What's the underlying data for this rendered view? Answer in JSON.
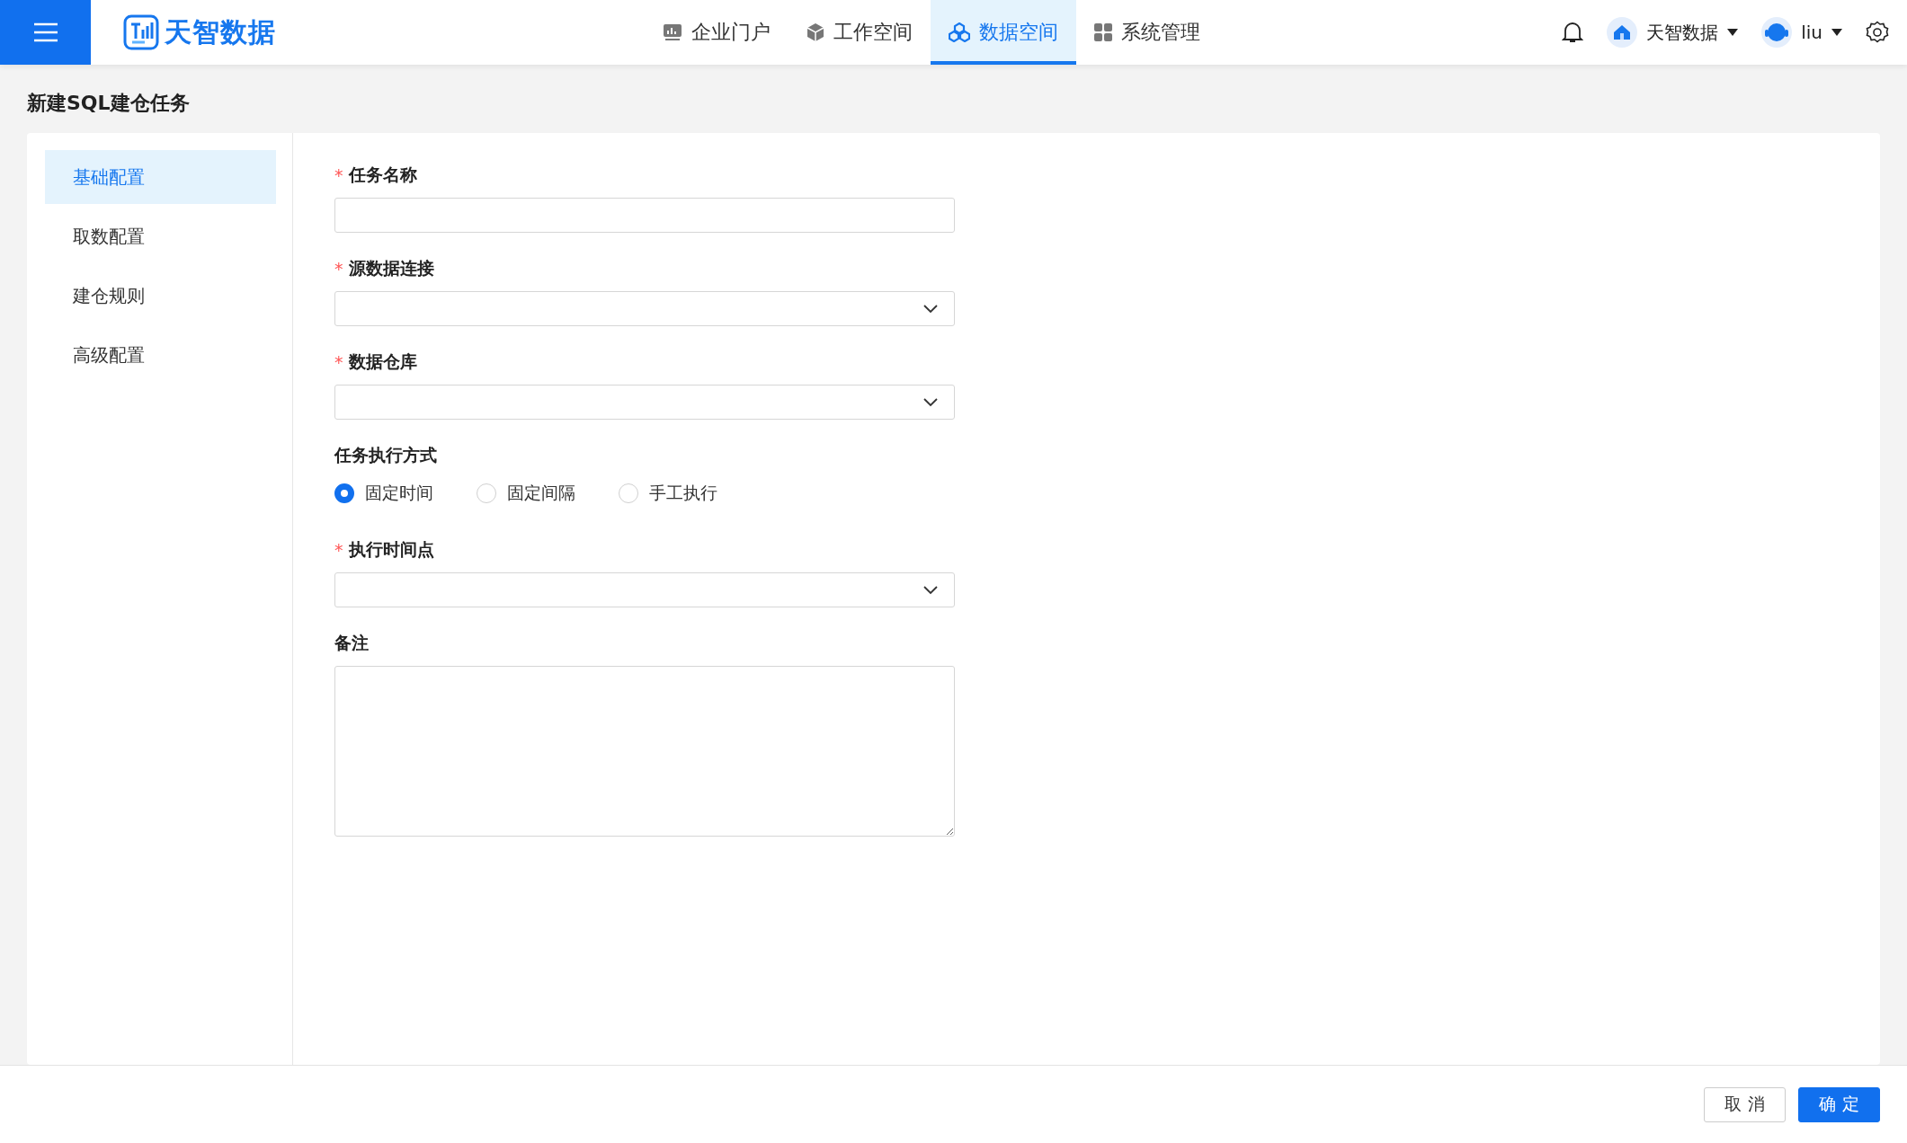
{
  "header": {
    "logo": "天智数据",
    "nav": [
      {
        "label": "企业门户",
        "selected": false
      },
      {
        "label": "工作空间",
        "selected": false
      },
      {
        "label": "数据空间",
        "selected": true
      },
      {
        "label": "系统管理",
        "selected": false
      }
    ],
    "org": "天智数据",
    "user": "liu"
  },
  "page_title": "新建SQL建仓任务",
  "sidebar": {
    "items": [
      {
        "label": "基础配置",
        "selected": true
      },
      {
        "label": "取数配置",
        "selected": false
      },
      {
        "label": "建仓规则",
        "selected": false
      },
      {
        "label": "高级配置",
        "selected": false
      }
    ]
  },
  "form": {
    "fields": [
      {
        "kind": "text",
        "label": "任务名称",
        "required_mark": "*"
      },
      {
        "kind": "select",
        "label": "源数据连接",
        "required_mark": "*"
      },
      {
        "kind": "select",
        "label": "数据仓库",
        "required_mark": "*"
      },
      {
        "kind": "radio",
        "label": "任务执行方式",
        "options": [
          {
            "label": "固定时间",
            "selected": true
          },
          {
            "label": "固定间隔",
            "selected": false
          },
          {
            "label": "手工执行",
            "selected": false
          }
        ]
      },
      {
        "kind": "select",
        "label": "执行时间点",
        "required_mark": "*"
      },
      {
        "kind": "textarea",
        "label": "备注"
      }
    ]
  },
  "footer": {
    "buttons": [
      {
        "label": "取 消",
        "kind": "secondary"
      },
      {
        "label": "确 定",
        "kind": "primary"
      }
    ]
  }
}
